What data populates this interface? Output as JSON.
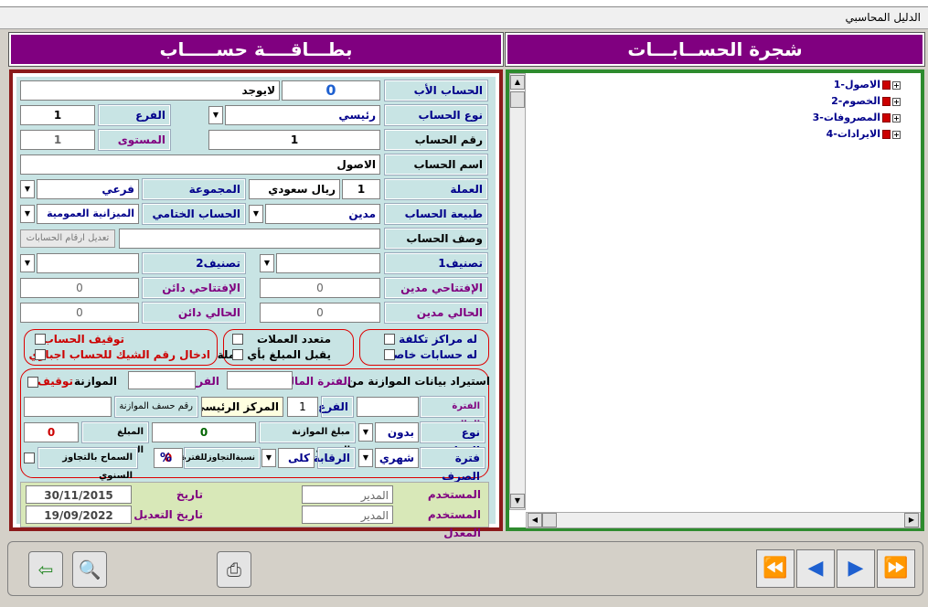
{
  "window": {
    "title": "الدليل المحاسبي"
  },
  "headers": {
    "card": "بطـــاقــــة حســـــاب",
    "tree": "شجرة الحســابـــات"
  },
  "form": {
    "parent_label": "الحساب الأب",
    "parent_code": "0",
    "parent_name": "لايوجد",
    "type_label": "نوع الحساب",
    "type_value": "رئيسي",
    "branch_label": "الفرع",
    "branch_value": "1",
    "number_label": "رقم الحساب",
    "number_value": "1",
    "level_label": "المستوى",
    "level_value": "1",
    "name_label": "اسم الحساب",
    "name_value": "الاصول",
    "currency_label": "العملة",
    "currency_code": "1",
    "currency_name": "ريال سعودي",
    "group_label": "المجموعة",
    "group_value": "فرعي",
    "nature_label": "طبيعة الحساب",
    "nature_value": "مدين",
    "final_label": "الحساب الختامي",
    "final_value": "الميزانية العمومية",
    "desc_label": "وصف الحساب",
    "desc_value": "",
    "edit_numbers_btn": "تعديل ارقام الحسابات",
    "class1_label": "تصنيف1",
    "class2_label": "تصنيف2",
    "open_debit_label": "الإفتتاحي مدين",
    "open_debit_value": "0",
    "open_credit_label": "الإفتتاحي دائن",
    "open_credit_value": "0",
    "cur_debit_label": "الحالي مدين",
    "cur_debit_value": "0",
    "cur_credit_label": "الحالي دائن",
    "cur_credit_value": "0"
  },
  "checks": {
    "cost_centers": "له مراكز تكلفة",
    "special_accounts": "له حسابات خاصة",
    "multi_currency": "متعدد العملات",
    "any_currency": "يقبل المبلغ بأي عملة",
    "stop_account": "توقيف الحساب",
    "check_required": "ادخال رقم الشيك للحساب اجباري"
  },
  "budget": {
    "import_label": "استيراد بيانات الموازنة من",
    "fiscal_label": "الفترة المالية",
    "branch_label": "الفرع",
    "budget_label": "الموازنة",
    "stop_label": "توقيف",
    "fiscal2_label": "الفترة المالية",
    "branch2_label": "الفرع",
    "branch2_value": "1",
    "center_value": "المركز الرئيسي",
    "budget_row_label": "رقم حسف الموازنة",
    "type_label": "نوع الموازنة",
    "type_value": "بدون",
    "annual_label": "مبلغ الموازنة السنوية",
    "annual_value": "0",
    "reserved_label": "المبلغ المحجوز",
    "reserved_value": "0",
    "period_label": "فترة الصرف",
    "period_value": "شهري",
    "control_label": "الرقابة",
    "control_value": "كلى",
    "exceed_label": "نسبةالتجاوزللفترة",
    "exceed_value": "0",
    "percent": "%",
    "allow_label": "السماح بالتجاوز السنوي"
  },
  "audit": {
    "entry_user_label": "المستخدم المدخل",
    "entry_user": "المدير",
    "edit_user_label": "المستخدم المعدل",
    "edit_user": "المدير",
    "entry_date_label": "تاريخ الإدخال",
    "entry_date": "30/11/2015",
    "edit_date_label": "تاريخ التعديل",
    "edit_date": "19/09/2022"
  },
  "tree": {
    "items": [
      "الاصول-1",
      "الخصوم-2",
      "المصروفات-3",
      "الايرادات-4"
    ]
  },
  "icons": {
    "exit": "exit-icon",
    "preview": "print-preview-icon",
    "print": "printer-icon",
    "first": "first-record-icon",
    "prev": "previous-record-icon",
    "next": "next-record-icon",
    "last": "last-record-icon"
  }
}
